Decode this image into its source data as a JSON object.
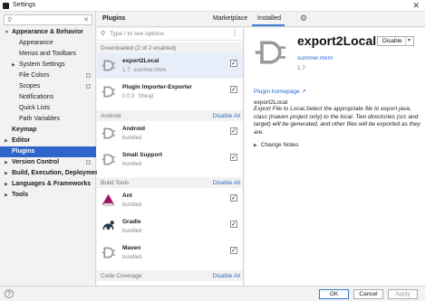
{
  "window": {
    "title": "Settings",
    "close_glyph": "✕"
  },
  "sidebar": {
    "search_placeholder": "",
    "items": [
      {
        "label": "Appearance & Behavior",
        "level": 0,
        "expanded": true,
        "bold": true
      },
      {
        "label": "Appearance",
        "level": 1
      },
      {
        "label": "Menus and Toolbars",
        "level": 1
      },
      {
        "label": "System Settings",
        "level": 1,
        "collapsed": true
      },
      {
        "label": "File Colors",
        "level": 1,
        "cfg": true
      },
      {
        "label": "Scopes",
        "level": 1,
        "cfg": true
      },
      {
        "label": "Notifications",
        "level": 1
      },
      {
        "label": "Quick Lists",
        "level": 1
      },
      {
        "label": "Path Variables",
        "level": 1
      },
      {
        "label": "Keymap",
        "level": 0,
        "bold": true
      },
      {
        "label": "Editor",
        "level": 0,
        "collapsed": true,
        "bold": true
      },
      {
        "label": "Plugins",
        "level": 0,
        "bold": true,
        "selected": true
      },
      {
        "label": "Version Control",
        "level": 0,
        "collapsed": true,
        "bold": true,
        "cfg": true
      },
      {
        "label": "Build, Execution, Deployment",
        "level": 0,
        "collapsed": true,
        "bold": true
      },
      {
        "label": "Languages & Frameworks",
        "level": 0,
        "collapsed": true,
        "bold": true
      },
      {
        "label": "Tools",
        "level": 0,
        "collapsed": true,
        "bold": true
      }
    ]
  },
  "header": {
    "title": "Plugins",
    "tab_marketplace": "Marketplace",
    "tab_installed": "Installed"
  },
  "list": {
    "search_placeholder": "Type / to see options",
    "groups": {
      "downloaded": {
        "label": "Downloaded (2 of 2 enabled)",
        "action": ""
      },
      "android": {
        "label": "Android",
        "action": "Disable All"
      },
      "build_tools": {
        "label": "Build Tools",
        "action": "Disable All"
      },
      "code_coverage": {
        "label": "Code Coverage",
        "action": "Disable All"
      }
    },
    "plugins": [
      {
        "name": "export2Local",
        "version": "1.7",
        "author": "summer.mkm",
        "checked": true,
        "selected": true
      },
      {
        "name": "Plugin Importer-Exporter",
        "version": "0.0.3",
        "author": "Shiraji",
        "checked": true
      },
      {
        "name": "Android",
        "version": "bundled",
        "author": "",
        "checked": true
      },
      {
        "name": "Smali Support",
        "version": "bundled",
        "author": "",
        "checked": true
      },
      {
        "name": "Ant",
        "version": "bundled",
        "author": "",
        "checked": true
      },
      {
        "name": "Gradle",
        "version": "bundled",
        "author": "",
        "checked": true
      },
      {
        "name": "Maven",
        "version": "bundled",
        "author": "",
        "checked": true
      }
    ]
  },
  "detail": {
    "name": "export2Local",
    "button": "Disable",
    "vendor": "summer.mkm",
    "version": "1.7",
    "homepage": "Plugin homepage ↗",
    "plugin_id": "export2Local",
    "description": "Export File to Local,Select the appropriate file to export java, class (maven project only) to the local. Two directories (src and target) will be generated, and other files will be exported as they are.",
    "change_notes": "Change Notes"
  },
  "footer": {
    "ok": "OK",
    "cancel": "Cancel",
    "apply": "Apply",
    "help": "?"
  },
  "colors": {
    "accent": "#2f65ca",
    "link": "#2e6bd0",
    "selected_row": "#e8eef9"
  }
}
